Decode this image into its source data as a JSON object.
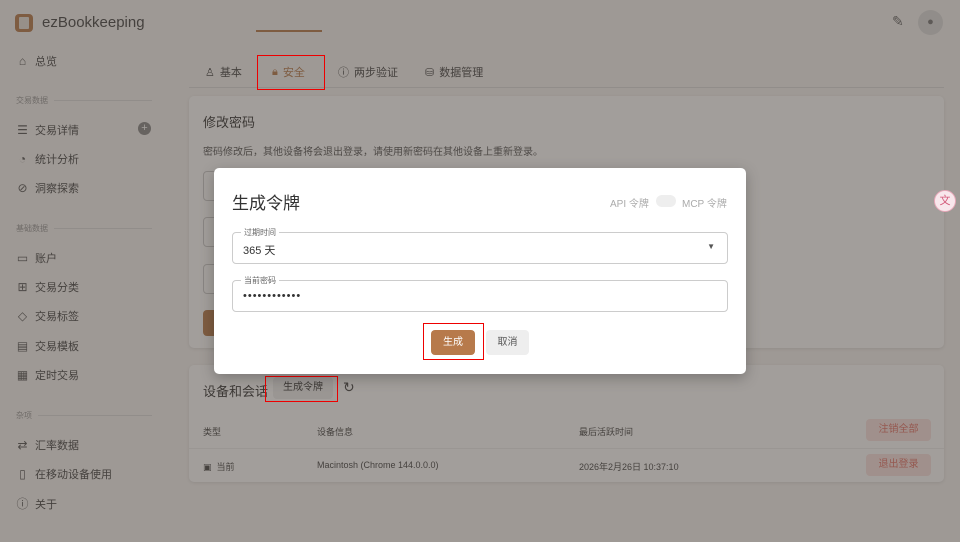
{
  "app": {
    "title": "ezBookkeeping"
  },
  "sidebar": {
    "overview": "总览",
    "section_transactions": "交易数据",
    "transaction_details": "交易详情",
    "statistics": "统计分析",
    "insights": "洞察探索",
    "section_basic": "基础数据",
    "accounts": "账户",
    "categories": "交易分类",
    "tags": "交易标签",
    "templates": "交易模板",
    "scheduled": "定时交易",
    "section_misc": "杂项",
    "exchange_rates": "汇率数据",
    "mobile": "在移动设备使用",
    "about": "关于"
  },
  "tabs": [
    {
      "label": "基本"
    },
    {
      "label": "安全"
    },
    {
      "label": "两步验证"
    },
    {
      "label": "数据管理"
    }
  ],
  "password_card": {
    "title": "修改密码",
    "description": "密码修改后，其他设备将会退出登录，请使用新密码在其他设备上重新登录。"
  },
  "sessions_card": {
    "title": "设备和会话",
    "generate_token": "生成令牌",
    "columns": [
      "类型",
      "设备信息",
      "最后活跃时间"
    ],
    "logout_all": "注销全部",
    "rows": [
      {
        "type": "当前",
        "device": "Macintosh (Chrome 144.0.0.0)",
        "last_active": "2026年2月26日 10:37:10",
        "action": "退出登录"
      }
    ]
  },
  "dialog": {
    "title": "生成令牌",
    "api_token": "API 令牌",
    "mcp_token": "MCP 令牌",
    "expiry_label": "过期时间",
    "expiry_value": "365 天",
    "password_label": "当前密码",
    "password_value": "••••••••••••",
    "generate": "生成",
    "cancel": "取消"
  },
  "colors": {
    "accent": "#b77a4b",
    "danger": "#e57368"
  }
}
